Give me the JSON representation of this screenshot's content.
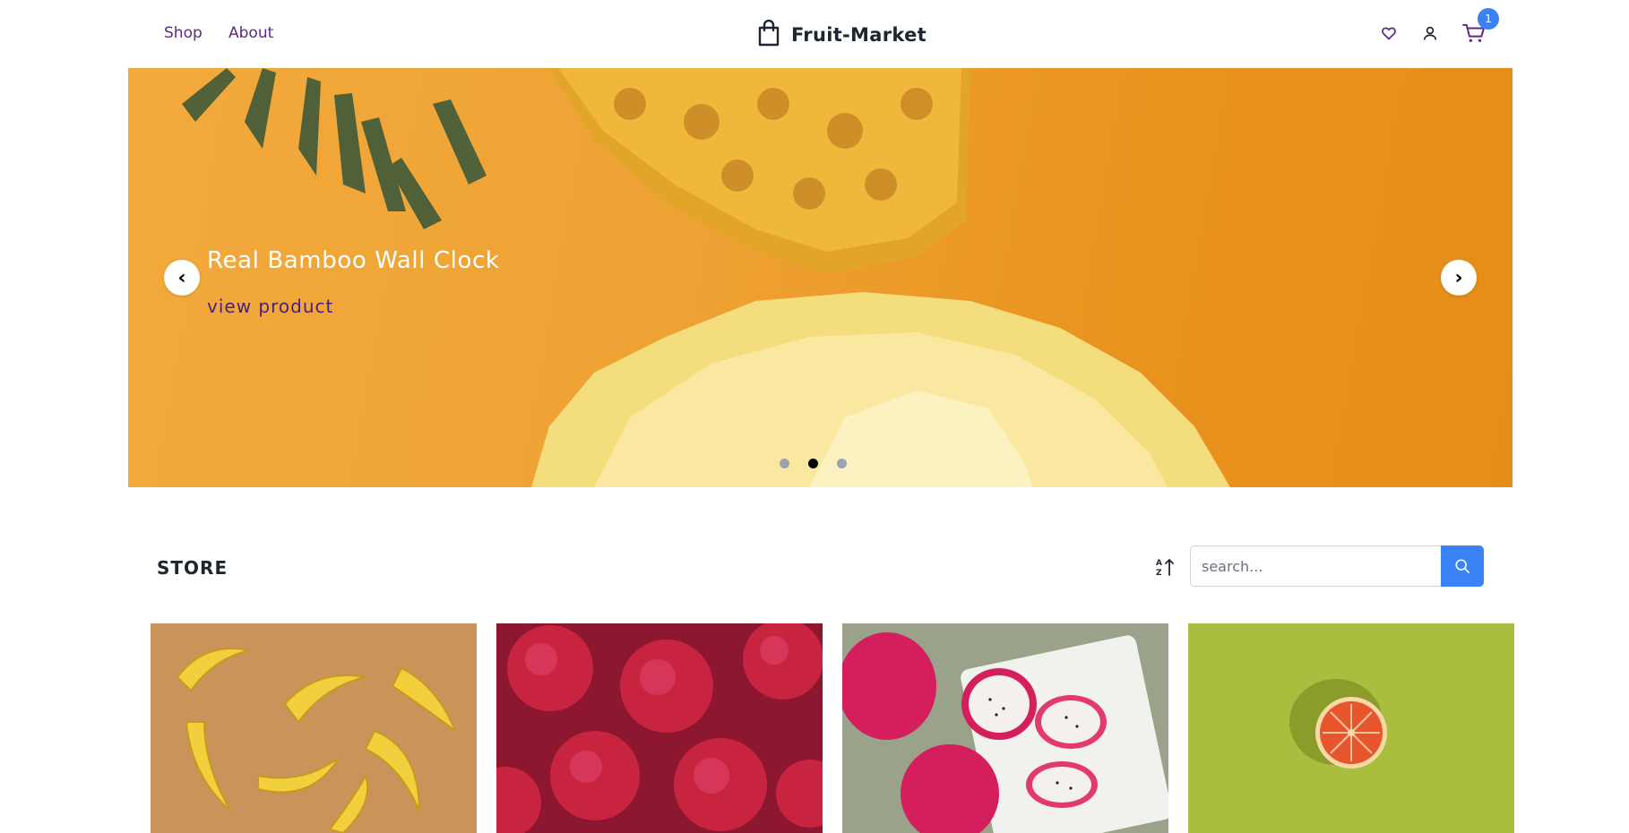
{
  "header": {
    "nav": [
      {
        "label": "Shop"
      },
      {
        "label": "About"
      }
    ],
    "brand": {
      "title": "Fruit-Market",
      "icon": "shopping-bag-icon"
    },
    "icons": [
      "heart-icon",
      "user-icon",
      "cart-icon"
    ],
    "cart_count": "1"
  },
  "hero": {
    "title": "Real Bamboo Wall Clock",
    "link_label": "view product",
    "prev_label": "‹",
    "next_label": "›",
    "slide_count": 3,
    "active_slide": 2,
    "image": "pineapple-on-orange"
  },
  "store": {
    "title": "STORE",
    "sort_icon": "sort-alpha-asc-icon",
    "search": {
      "placeholder": "search...",
      "value": ""
    },
    "search_icon": "search-icon"
  },
  "products": [
    {
      "image": "bananas"
    },
    {
      "image": "raspberries"
    },
    {
      "image": "dragon-fruit"
    },
    {
      "image": "grapefruit-half"
    }
  ],
  "colors": {
    "accent": "#3b82f6",
    "nav_text": "#5b2a86",
    "hero_bg": "#efa234",
    "heading_text": "#1f2530"
  }
}
